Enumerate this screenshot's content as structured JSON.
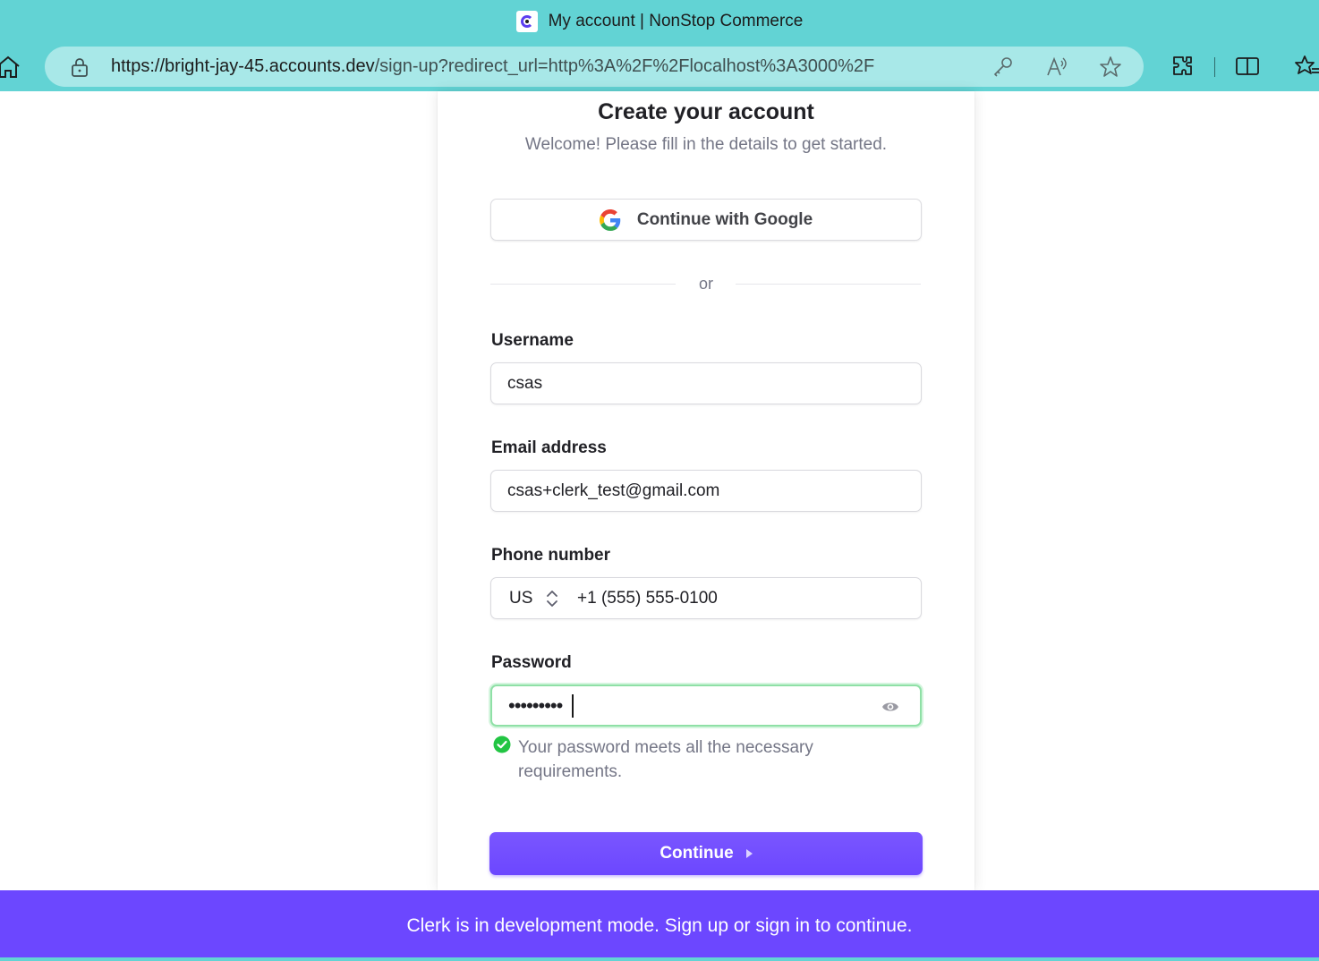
{
  "browser": {
    "tab_title": "My account | NonStop Commerce",
    "url_host": "https://bright-jay-45.accounts.dev",
    "url_path": "/sign-up?redirect_url=http%3A%2F%2Flocalhost%3A3000%2F",
    "icons": [
      "home-icon",
      "lock-icon",
      "key-icon",
      "read-aloud-icon",
      "favorite-star-icon",
      "extensions-icon",
      "split-screen-icon",
      "favorites-icon"
    ]
  },
  "card": {
    "title": "Create your account",
    "subtitle": "Welcome! Please fill in the details to get started.",
    "google_button": "Continue with Google",
    "divider": "or",
    "username": {
      "label": "Username",
      "value": "csas"
    },
    "email": {
      "label": "Email address",
      "value": "csas+clerk_test@gmail.com"
    },
    "phone": {
      "label": "Phone number",
      "country": "US",
      "value": "+1 (555) 555-0100"
    },
    "password": {
      "label": "Password",
      "value": "•••••••••"
    },
    "password_message": "Your password meets all the necessary requirements.",
    "continue_button": "Continue"
  },
  "banner": {
    "text": "Clerk is in development mode. Sign up or sign in to continue."
  },
  "colors": {
    "accent": "#6c47ff",
    "browser": "#62d3d4",
    "success": "#22c543"
  }
}
